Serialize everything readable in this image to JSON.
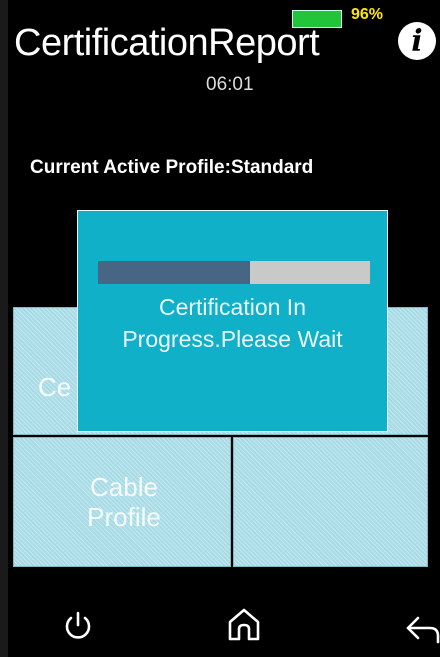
{
  "status": {
    "battery_percent": "96%",
    "battery_level": 0.96
  },
  "header": {
    "title": "CertificationReport",
    "time": "06:01",
    "info_icon": "i"
  },
  "profile": {
    "text": "Current Active Profile:Standard"
  },
  "tiles": [
    {
      "label": "Ce"
    },
    {
      "label": "Cable Profile"
    },
    {
      "label": ""
    }
  ],
  "modal": {
    "message": "Certification In Progress.Please Wait",
    "progress": 0.56
  },
  "bottom_nav": {
    "icons": [
      "power-icon",
      "home-icon",
      "back-icon"
    ]
  },
  "colors": {
    "modal_bg": "#0fb0c8",
    "progress_fill": "#466683",
    "battery": "#22c53a",
    "battery_text": "#ffe600"
  }
}
